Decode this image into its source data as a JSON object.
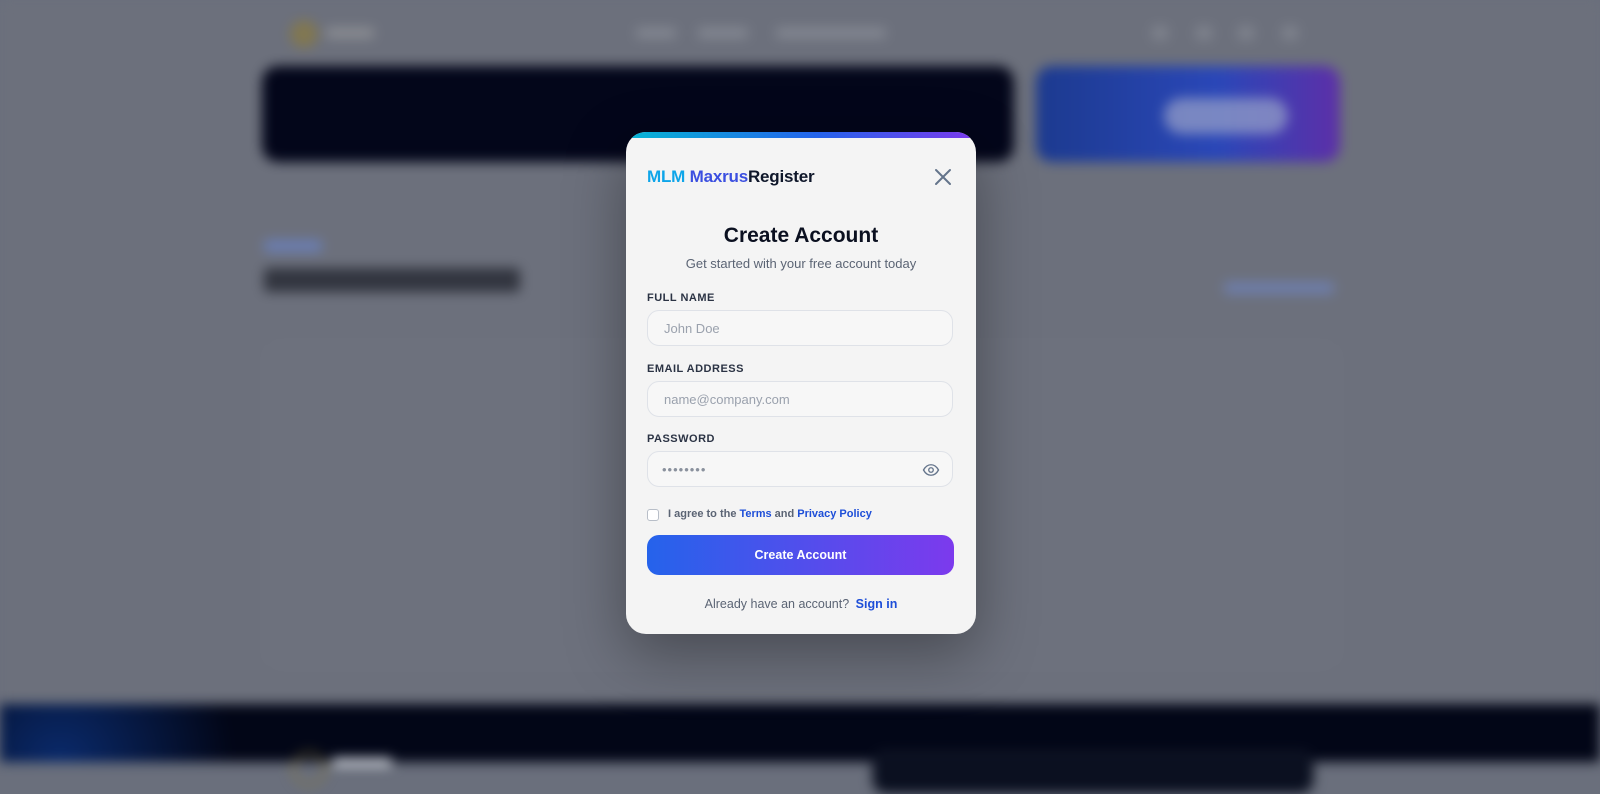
{
  "modal": {
    "brand_part1": "MLM",
    "brand_part2": "Maxrus",
    "brand_part3": "Register",
    "title": "Create Account",
    "subtitle": "Get started with your free account today",
    "full_name": {
      "label": "FULL NAME",
      "placeholder": "John Doe",
      "value": ""
    },
    "email": {
      "label": "EMAIL ADDRESS",
      "placeholder": "name@company.com",
      "value": ""
    },
    "password": {
      "label": "PASSWORD",
      "masked_value": "••••••••"
    },
    "agree": {
      "prefix": "I agree to the",
      "terms": "Terms",
      "and": "and",
      "privacy": "Privacy Policy",
      "checked": false
    },
    "submit_label": "Create Account",
    "signin_prompt": "Already have an account?",
    "signin_link": "Sign in"
  },
  "icons": {
    "close": "close-icon",
    "toggle_password": "eye-icon"
  },
  "colors": {
    "accent_blue": "#2563eb",
    "accent_purple": "#7c3aed",
    "accent_cyan": "#06b6d4",
    "link": "#1d4ed8"
  }
}
